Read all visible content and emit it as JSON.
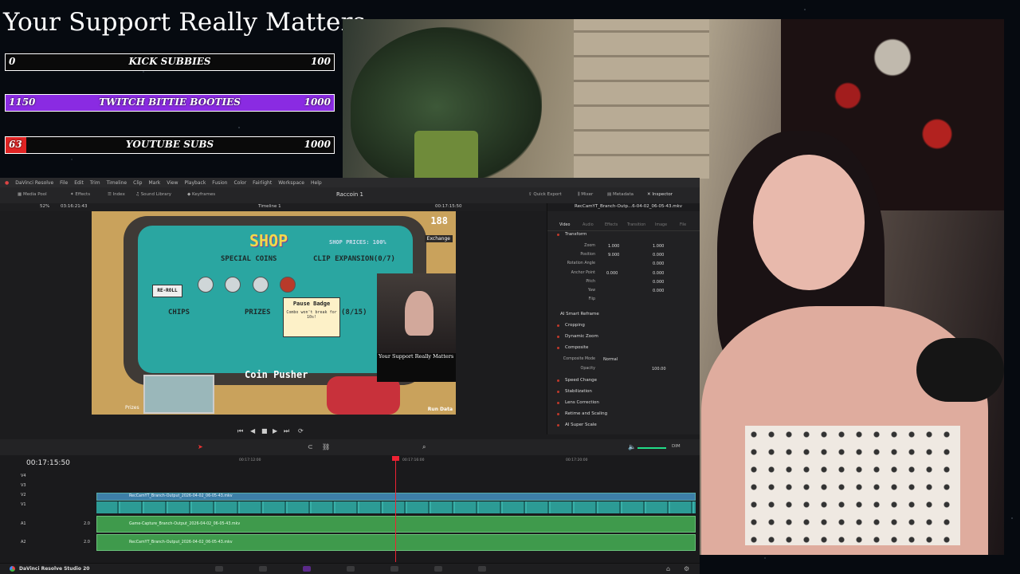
{
  "overlay": {
    "title": "Your Support Really Matters",
    "goals": [
      {
        "current": "0",
        "name": "KICK SUBBIES",
        "max": "100",
        "fill": 0.0,
        "color": "#000000"
      },
      {
        "current": "1150",
        "name": "TWITCH BITTIE BOOTIES",
        "max": "1000",
        "fill": 1.0,
        "color": "#8a2be2"
      },
      {
        "current": "63",
        "name": "YOUTUBE SUBS",
        "max": "1000",
        "fill": 0.063,
        "color": "#e02424"
      }
    ]
  },
  "resolve": {
    "menu": [
      "DaVinci Resolve",
      "File",
      "Edit",
      "Trim",
      "Timeline",
      "Clip",
      "Mark",
      "View",
      "Playback",
      "Fusion",
      "Color",
      "Fairlight",
      "Workspace",
      "Help"
    ],
    "toolbar": {
      "media_pool": "Media Pool",
      "effects": "Effects",
      "index": "Index",
      "sound_library": "Sound Library",
      "keyframes": "Keyframes",
      "project_title": "Raccoin 1",
      "quick_export": "Quick Export",
      "mixer": "Mixer",
      "metadata": "Metadata",
      "inspector": "Inspector"
    },
    "viewer": {
      "zoom": "52%",
      "duration": "03:16:21:43",
      "timeline_name": "Timeline 1",
      "timecode": "00:17:15:50"
    },
    "game": {
      "shop_title": "SHOP",
      "shop_prices": "SHOP PRICES: 100%",
      "coins": "188",
      "exchange": "Exchange",
      "special_coins": "SPECIAL COINS",
      "clip_expansion": "CLIP EXPANSION(0/7)",
      "reroll": "RE-ROLL",
      "chips": "CHIPS",
      "prizes": "PRIZES",
      "tooltip_title": "Pause Badge",
      "tooltip_body": "Combo won't break for 10s!",
      "count": "(8/15)",
      "coin_pusher": "Coin Pusher",
      "prizes_bottom": "Prizes",
      "run_data": "Run Data",
      "pip_title": "Your Support Really Matters"
    },
    "inspector": {
      "file": "RecCamYT_Branch-Outp...6-04-02_06-05-43.mkv",
      "tabs": [
        "Video",
        "Audio",
        "Effects",
        "Transition",
        "Image",
        "File"
      ],
      "transform": "Transform",
      "params": [
        {
          "label": "Zoom",
          "x": "1.000",
          "y": "1.000"
        },
        {
          "label": "Position",
          "x": "9.000",
          "y": "0.000"
        },
        {
          "label": "Rotation Angle",
          "x": "",
          "y": "0.000"
        },
        {
          "label": "Anchor Point",
          "x": "0.000",
          "y": "0.000"
        },
        {
          "label": "Pitch",
          "x": "",
          "y": "0.000"
        },
        {
          "label": "Yaw",
          "x": "",
          "y": "0.000"
        },
        {
          "label": "Flip",
          "x": "",
          "y": ""
        }
      ],
      "ai_smart_reframe": "AI Smart Reframe",
      "cropping": "Cropping",
      "dynamic_zoom": "Dynamic Zoom",
      "composite": "Composite",
      "composite_mode_label": "Composite Mode",
      "composite_mode_value": "Normal",
      "opacity_label": "Opacity",
      "opacity_value": "100.00",
      "speed_change": "Speed Change",
      "stabilization": "Stabilization",
      "lens_correction": "Lens Correction",
      "retime": "Retime and Scaling",
      "ai_super_scale": "AI Super Scale"
    },
    "timeline": {
      "timecode": "00:17:15:50",
      "ruler": [
        "00:17:12:00",
        "00:17:16:00",
        "00:17:20:00"
      ],
      "video_tracks": [
        "V4",
        "V3",
        "V2",
        "V1"
      ],
      "audio_tracks": [
        "A1",
        "A2"
      ],
      "v2_clip": "RecCamYT_Branch-Output_2026-04-02_06-05-43.mkv",
      "a1_clip": "Game-Capture_Branch-Output_2026-04-02_06-05-43.mkv",
      "a2_clip": "RecCamYT_Branch-Output_2026-04-02_06-05-43.mkv",
      "a_level": "2.0",
      "dim": "DIM"
    },
    "app_name": "DaVinci Resolve Studio 20"
  }
}
